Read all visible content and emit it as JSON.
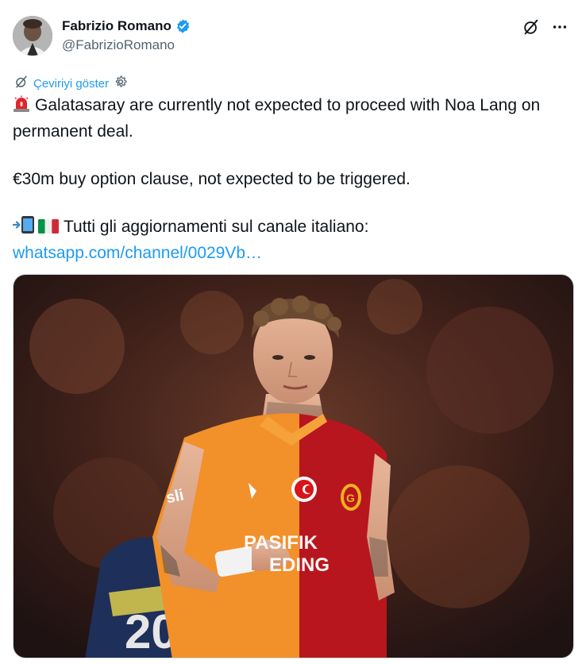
{
  "author": {
    "display_name": "Fabrizio Romano",
    "handle": "@FabrizioRomano",
    "verified": true
  },
  "actions": {
    "grok_icon": "grok-icon",
    "more_icon": "more-icon"
  },
  "translate": {
    "label": "Çeviriyi göster"
  },
  "tweet": {
    "line1": "Galatasaray are currently not expected to proceed with Noa Lang on permanent deal.",
    "line2": "€30m buy option clause, not expected to be triggered.",
    "line3": "Tutti gli aggiornamenti sul canale italiano:",
    "link_text": "whatsapp.com/channel/0029Vb…"
  },
  "media": {
    "jersey_text_1": "PASIFIK",
    "jersey_text_2": "EDING",
    "sleeve_text": "sli",
    "colors": {
      "orange": "#f2902a",
      "red": "#b8161e",
      "link": "#1d9bf0"
    }
  }
}
